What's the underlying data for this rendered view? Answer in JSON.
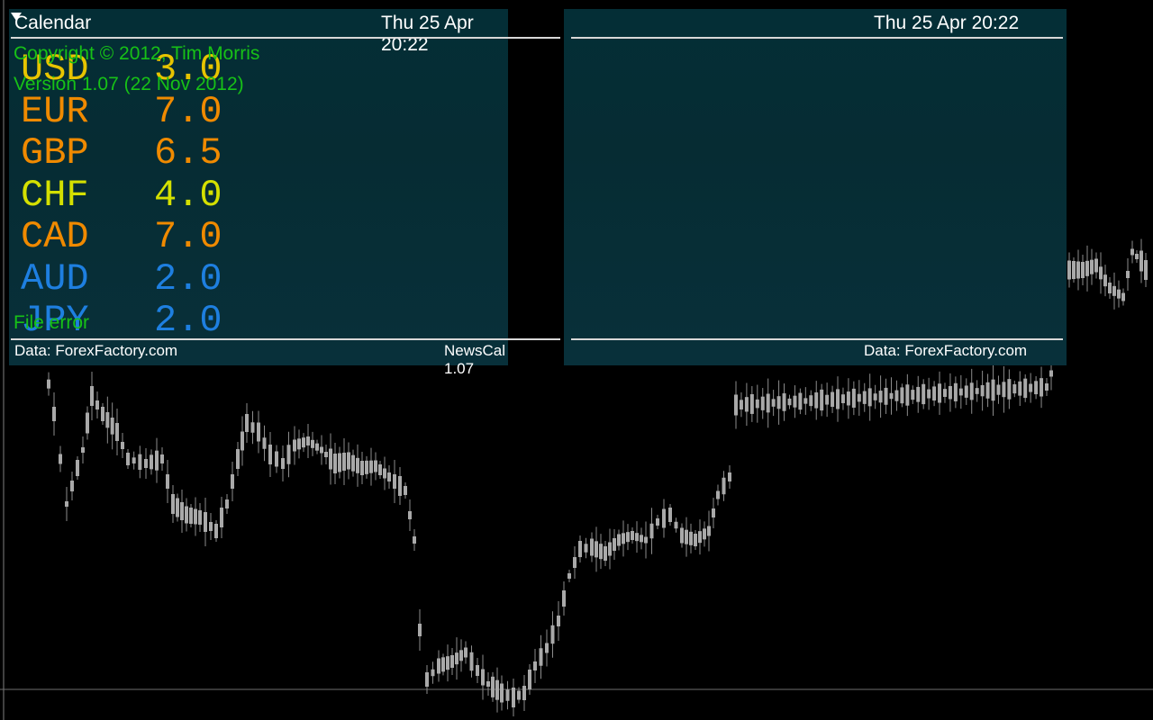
{
  "calendar": {
    "title": "Calendar",
    "left_datetime": "Thu 25 Apr 20:22",
    "right_datetime": "Thu 25 Apr 20:22",
    "copyright": "Copyright © 2012, Tim Morris",
    "version": "Version 1.07 (22 Nov 2012)",
    "file_error": "File error",
    "footer_left": "Data: ForexFactory.com",
    "footer_center": "NewsCal 1.07",
    "footer_right": "Data: ForexFactory.com"
  },
  "currencies": [
    {
      "code": "USD",
      "value": "3.0",
      "color": "#e7c400"
    },
    {
      "code": "EUR",
      "value": "7.0",
      "color": "#f08a00"
    },
    {
      "code": "GBP",
      "value": "6.5",
      "color": "#f08a00"
    },
    {
      "code": "CHF",
      "value": "4.0",
      "color": "#d4e000"
    },
    {
      "code": "CAD",
      "value": "7.0",
      "color": "#f08a00"
    },
    {
      "code": "AUD",
      "value": "2.0",
      "color": "#1e7fe0"
    },
    {
      "code": "JPY",
      "value": "2.0",
      "color": "#1e7fe0"
    }
  ],
  "colors": {
    "background": "#000000",
    "candle": "#a9a9a9",
    "gridline": "#808080",
    "panel": "#053036",
    "accent_green": "#17c117"
  }
}
